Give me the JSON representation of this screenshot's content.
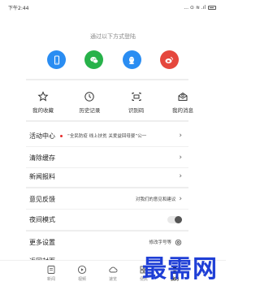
{
  "status_bar": {
    "time": "下午2:44",
    "signal": "... ⊙ ≋ .ıl"
  },
  "login": {
    "title": "通过以下方式登陆",
    "options": [
      {
        "name": "phone",
        "color": "#2a8df2",
        "icon": "phone-icon"
      },
      {
        "name": "wechat",
        "color": "#27b24a",
        "icon": "wechat-icon"
      },
      {
        "name": "qq",
        "color": "#2a8df2",
        "icon": "qq-icon"
      },
      {
        "name": "weibo",
        "color": "#e5473d",
        "icon": "weibo-icon"
      }
    ]
  },
  "shortcuts": [
    {
      "label": "我的收藏",
      "icon": "star-icon"
    },
    {
      "label": "历史记录",
      "icon": "clock-icon"
    },
    {
      "label": "识别码",
      "icon": "scan-icon"
    },
    {
      "label": "我的消息",
      "icon": "message-icon"
    }
  ],
  "menu": {
    "activity": {
      "label": "活动中心",
      "ticker": "“全民防疫 线上扶贫 关爱益回母婴”公一"
    },
    "clear_cache": {
      "label": "清除缓存"
    },
    "news_report": {
      "label": "新闻报料"
    },
    "feedback": {
      "label": "意见反馈",
      "hint": "对我们的意见和建议"
    },
    "night_mode": {
      "label": "夜间模式",
      "enabled": false
    },
    "more_settings": {
      "label": "更多设置",
      "hint": "修改字号等"
    },
    "back_home": {
      "label": "返回封面"
    }
  },
  "tabs": [
    {
      "label": "新闻",
      "icon": "news-icon",
      "active": false
    },
    {
      "label": "视频",
      "icon": "video-icon",
      "active": false
    },
    {
      "label": "速览",
      "icon": "cloud-icon",
      "active": false
    },
    {
      "label": "便民",
      "icon": "service-icon",
      "active": false
    },
    {
      "label": "我的",
      "icon": "user-icon",
      "active": true
    }
  ],
  "watermark": "最需网"
}
